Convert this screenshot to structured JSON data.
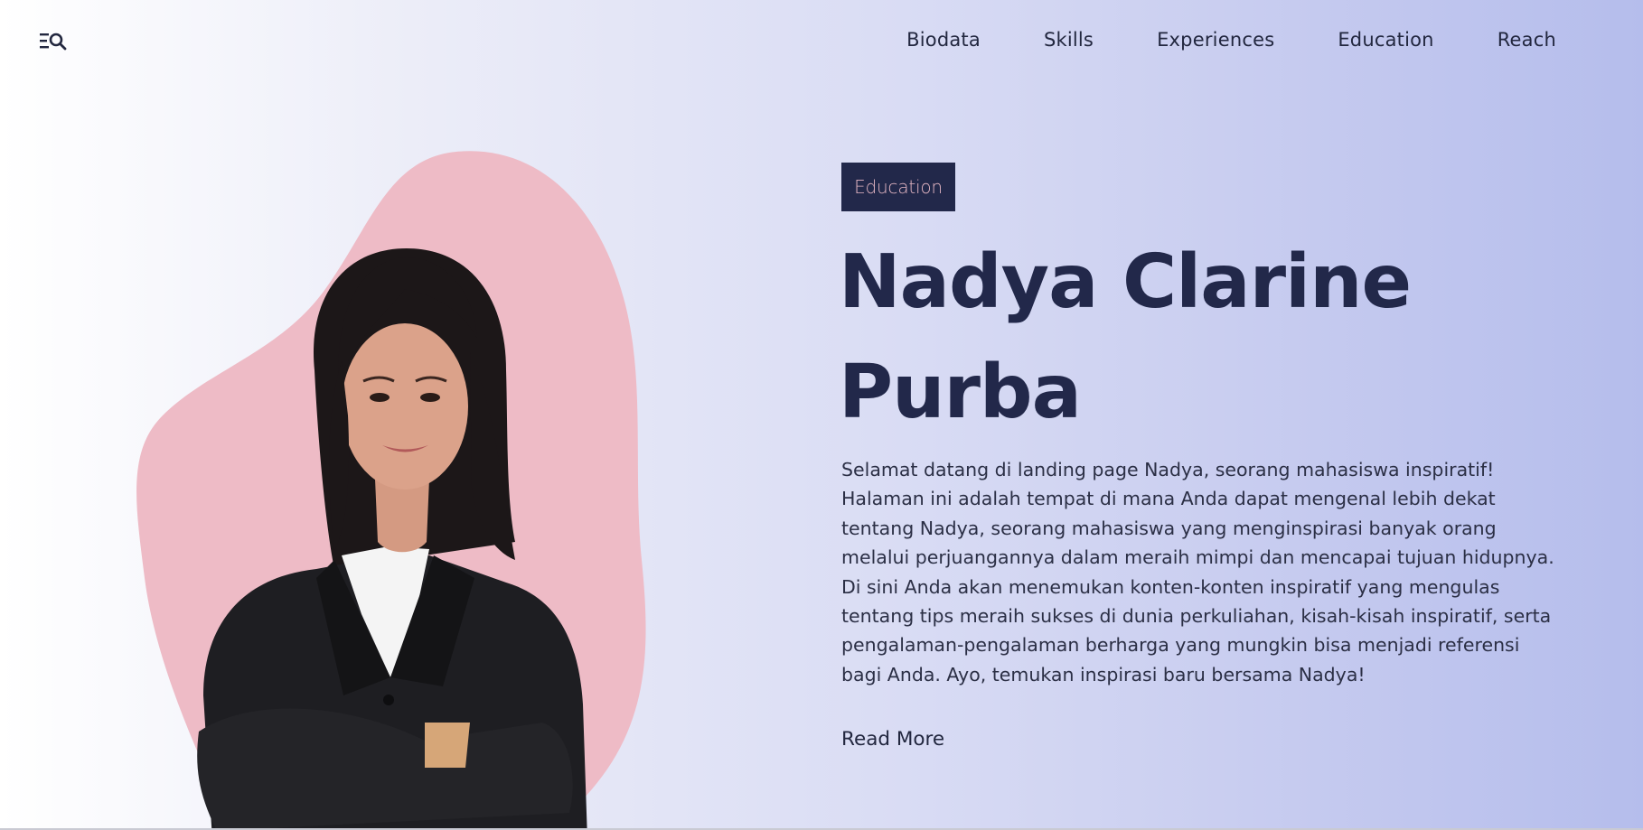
{
  "nav": {
    "menu_icon": "menu-search-icon",
    "items": [
      {
        "label": "Biodata"
      },
      {
        "label": "Skills"
      },
      {
        "label": "Experiences"
      },
      {
        "label": "Education"
      },
      {
        "label": "Reach"
      }
    ]
  },
  "hero": {
    "badge": "Education",
    "title_line1": "Nadya Clarine",
    "title_line2": "Purba",
    "description": "Selamat datang di landing page Nadya, seorang mahasiswa inspiratif! Halaman ini adalah tempat di mana Anda dapat mengenal lebih dekat tentang Nadya, seorang mahasiswa yang menginspirasi banyak orang melalui perjuangannya dalam meraih mimpi dan mencapai tujuan hidupnya. Di sini Anda akan menemukan konten-konten inspiratif yang mengulas tentang tips meraih sukses di dunia perkuliahan, kisah-kisah inspiratif, serta pengalaman-pengalaman berharga yang mungkin bisa menjadi referensi bagi Anda. Ayo, temukan inspirasi baru bersama Nadya!",
    "read_more": "Read More"
  },
  "colors": {
    "accent_dark": "#22284a",
    "blob_pink": "#eebbc6",
    "badge_text": "#e4b6c3",
    "gradient_end": "#b5bdec"
  }
}
